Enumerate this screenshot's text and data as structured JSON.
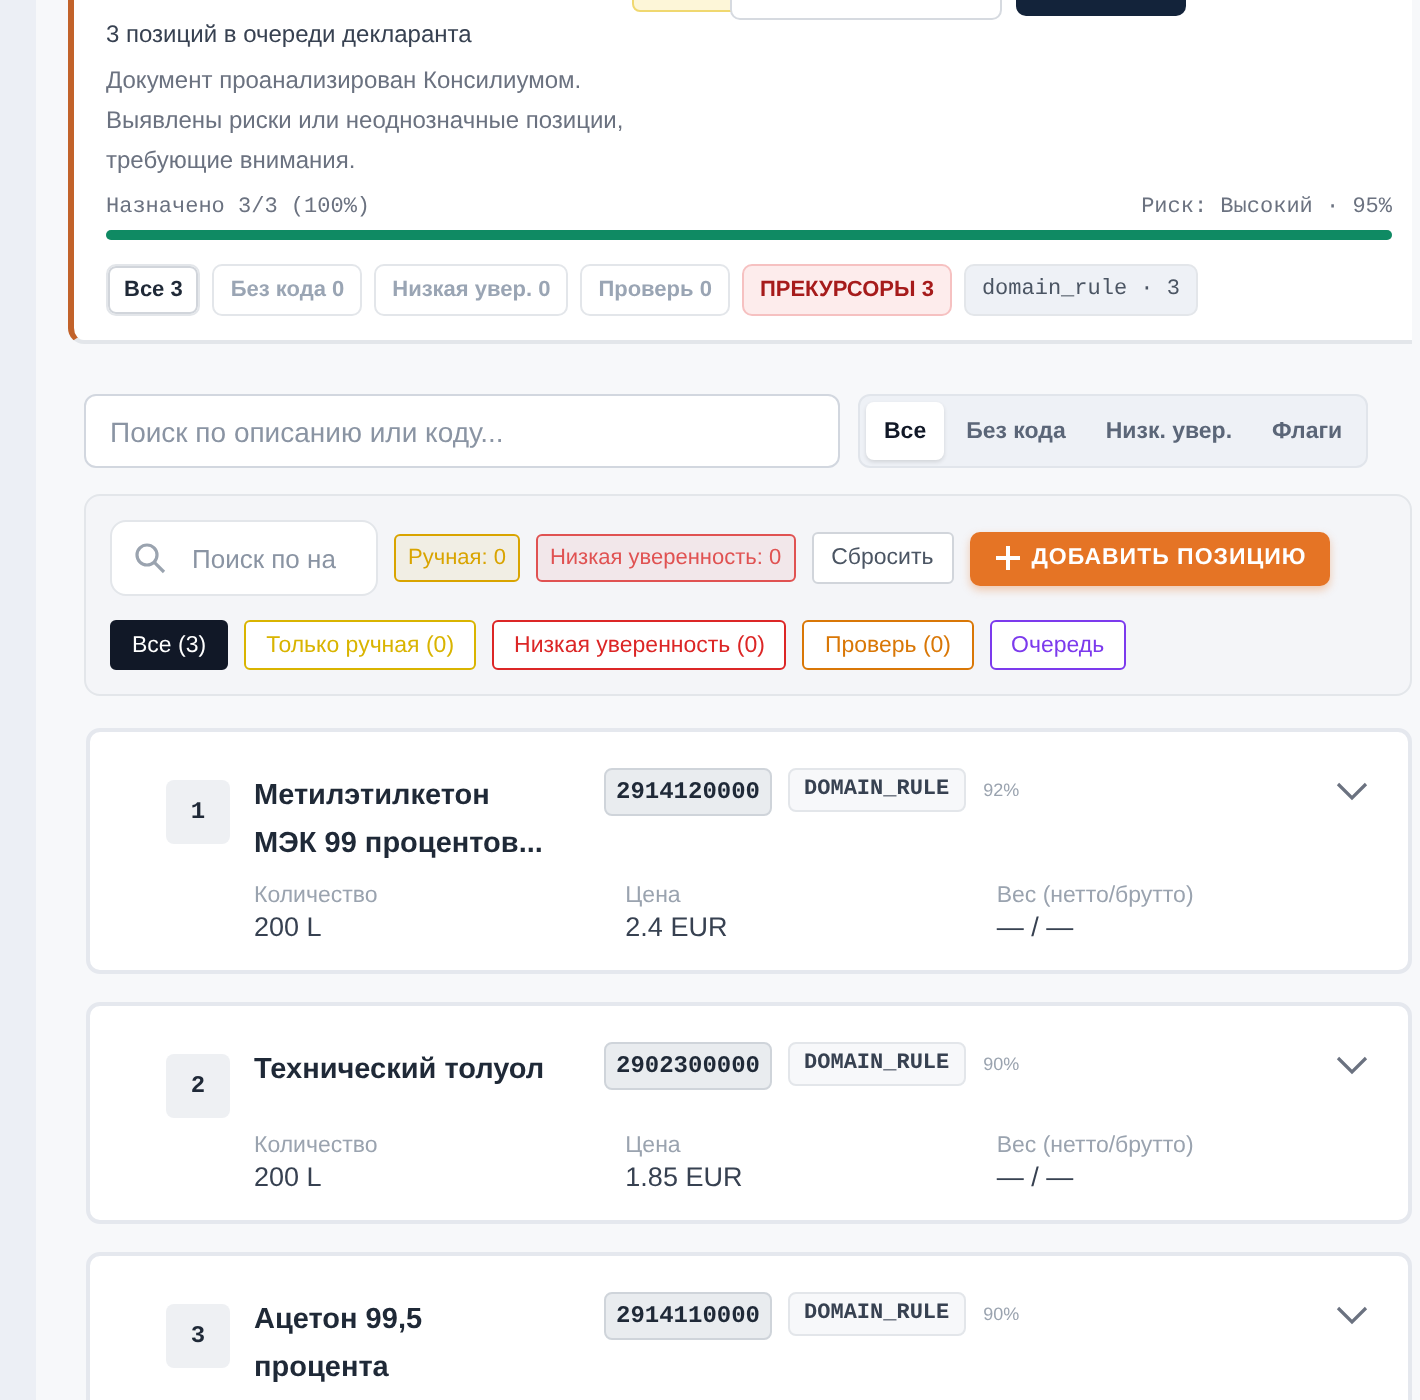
{
  "summary": {
    "queue_text": "3 позиций в очереди декларанта",
    "description": "Документ проанализирован Консилиумом. Выявлены риски или неоднозначные позиции, требующие внимания.",
    "assigned": "Назначено 3/3 (100%)",
    "risk": "Риск: Высокий · 95%",
    "level": 1,
    "chips": [
      {
        "label": "Все 3",
        "kind": "strong",
        "selected": true
      },
      {
        "label": "Без кода 0",
        "kind": "muted",
        "selected": false
      },
      {
        "label": "Низкая увер. 0",
        "kind": "muted",
        "selected": false
      },
      {
        "label": "Проверь 0",
        "kind": "muted",
        "selected": false
      },
      {
        "label": "ПРЕКУРСОРЫ 3",
        "kind": "danger",
        "selected": false
      },
      {
        "label": "domain_rule · 3",
        "kind": "tag",
        "selected": false
      }
    ]
  },
  "search": {
    "placeholder": "Поиск по описанию или коду..."
  },
  "tabs": [
    {
      "label": "Все",
      "selected": true
    },
    {
      "label": "Без кода",
      "selected": false
    },
    {
      "label": "Низк. увер.",
      "selected": false
    },
    {
      "label": "Флаги",
      "selected": false
    }
  ],
  "filters": {
    "search_placeholder": "Поиск по на",
    "badges": [
      {
        "label": "Ручная: 0",
        "color": "#d9a400"
      },
      {
        "label": "Низкая уверенность: 0",
        "color": "#e05252"
      }
    ],
    "reset": "Сбросить",
    "add": "ДОБАВИТЬ ПОЗИЦИЮ",
    "chips": [
      {
        "label": "Все (3)",
        "color": "#111827",
        "selected": true
      },
      {
        "label": "Только ручная (0)",
        "color": "#d9b400",
        "selected": false
      },
      {
        "label": "Низкая уверенность (0)",
        "color": "#dc2626",
        "selected": false
      },
      {
        "label": "Проверь (0)",
        "color": "#d97706",
        "selected": false
      },
      {
        "label": "Очередь",
        "color": "#7c3aed",
        "selected": false
      }
    ]
  },
  "items": [
    {
      "number": "1",
      "title": "Метилэтилкетон МЭК 99 процентов...",
      "code": "2914120000",
      "rule": "DOMAIN_RULE",
      "confidence": "92%",
      "fields": [
        {
          "label": "Количество",
          "value": "200 L"
        },
        {
          "label": "Цена",
          "value": "2.4 EUR"
        },
        {
          "label": "Вес (нетто/брутто)",
          "value": "— / —"
        }
      ]
    },
    {
      "number": "2",
      "title": "Технический толуол",
      "code": "2902300000",
      "rule": "DOMAIN_RULE",
      "confidence": "90%",
      "fields": [
        {
          "label": "Количество",
          "value": "200 L"
        },
        {
          "label": "Цена",
          "value": "1.85 EUR"
        },
        {
          "label": "Вес (нетто/брутто)",
          "value": "— / —"
        }
      ]
    },
    {
      "number": "3",
      "title": "Ацетон 99,5 процента",
      "code": "2914110000",
      "rule": "DOMAIN_RULE",
      "confidence": "90%"
    }
  ]
}
